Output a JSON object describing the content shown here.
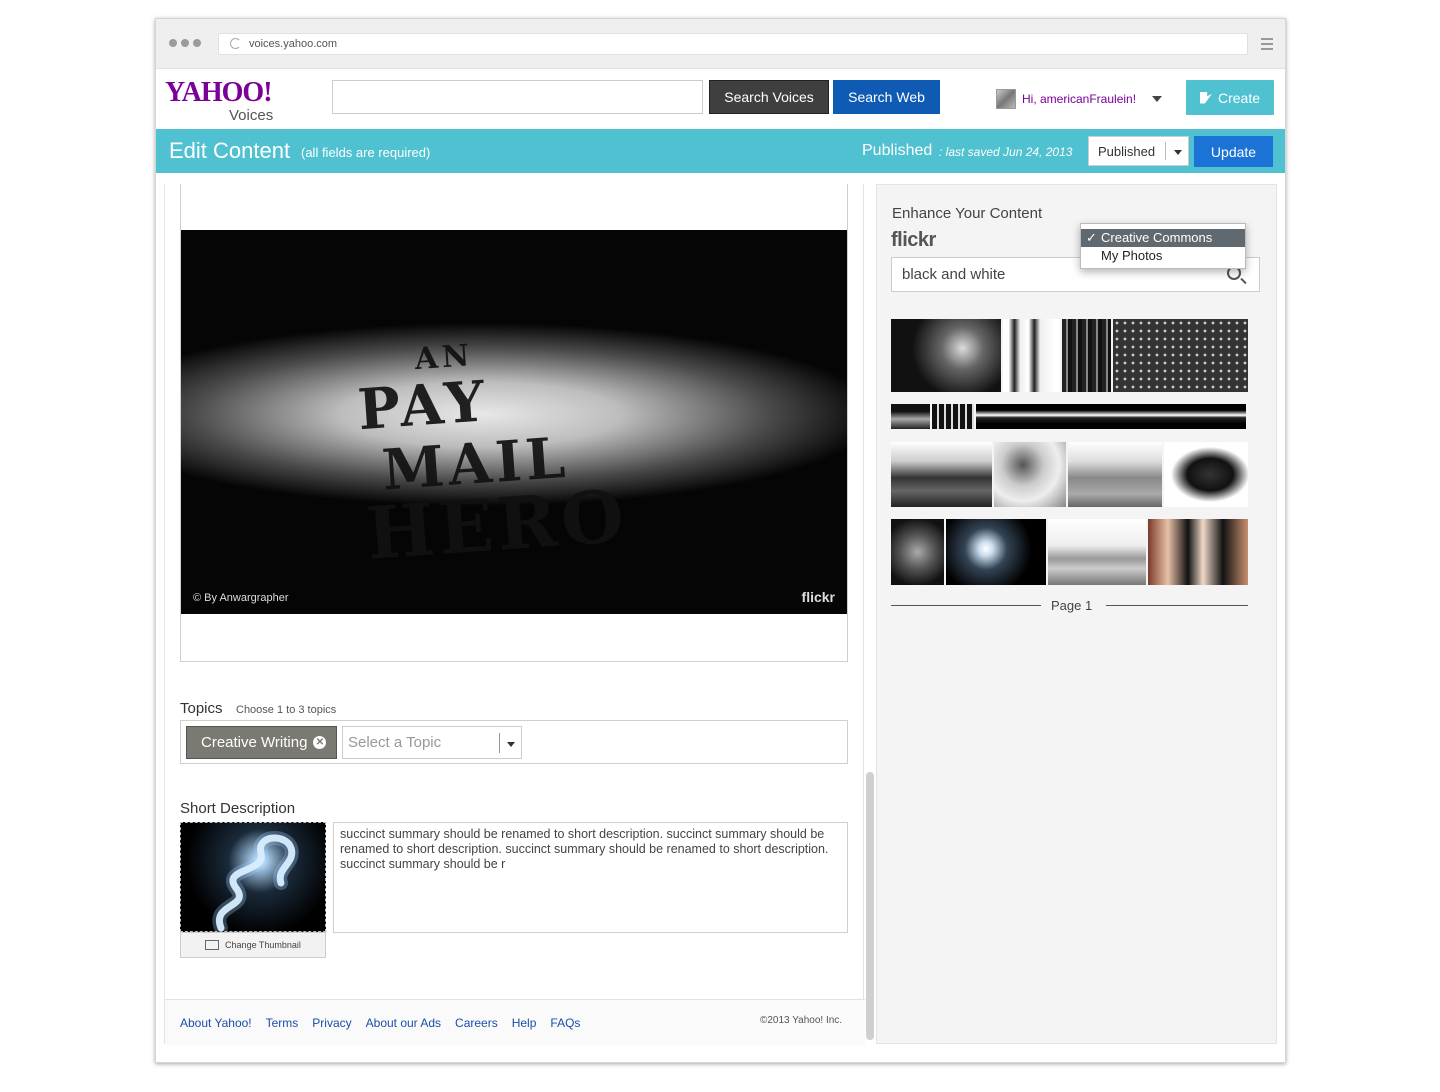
{
  "browser": {
    "url": "voices.yahoo.com"
  },
  "header": {
    "logo_yahoo": "YAHOO!",
    "logo_voices": "Voices",
    "search_placeholder": "",
    "search_voices_label": "Search Voices",
    "search_web_label": "Search Web",
    "greeting": "Hi, americanFraulein!",
    "create_label": "Create"
  },
  "editbar": {
    "title": "Edit Content",
    "subtitle": "(all fields are required)",
    "status": "Published",
    "saved": ": last saved Jun 24, 2013",
    "status_select": "Published",
    "update_label": "Update"
  },
  "editor": {
    "photo_credit": "© By Anwargrapher",
    "photo_brand": "flickr",
    "photo_words": [
      "AN",
      "PAY",
      "MAIL",
      "HERO"
    ]
  },
  "topics": {
    "label": "Topics",
    "hint": "Choose 1 to 3 topics",
    "selected": "Creative Writing",
    "select_placeholder": "Select a Topic"
  },
  "short_description": {
    "label": "Short Description",
    "text": "succinct summary should be renamed to short description. succinct summary should be renamed to short description. succinct summary should be renamed to short description. succinct summary should be r",
    "change_thumbnail": "Change Thumbnail"
  },
  "footer": {
    "links": [
      "About Yahoo!",
      "Terms",
      "Privacy",
      "About our Ads",
      "Careers",
      "Help",
      "FAQs"
    ],
    "copyright": "©2013  Yahoo! Inc."
  },
  "enhance": {
    "title": "Enhance Your Content",
    "source": "flickr",
    "search_value": "black and white",
    "dropdown_options": [
      "Creative Commons",
      "My Photos"
    ],
    "dropdown_selected": "Creative Commons",
    "page_label": "Page 1"
  },
  "colors": {
    "accent": "#4fc1d1",
    "update_blue": "#1c73d6",
    "search_web_blue": "#0f5bb3",
    "yahoo_purple": "#7b0099"
  }
}
